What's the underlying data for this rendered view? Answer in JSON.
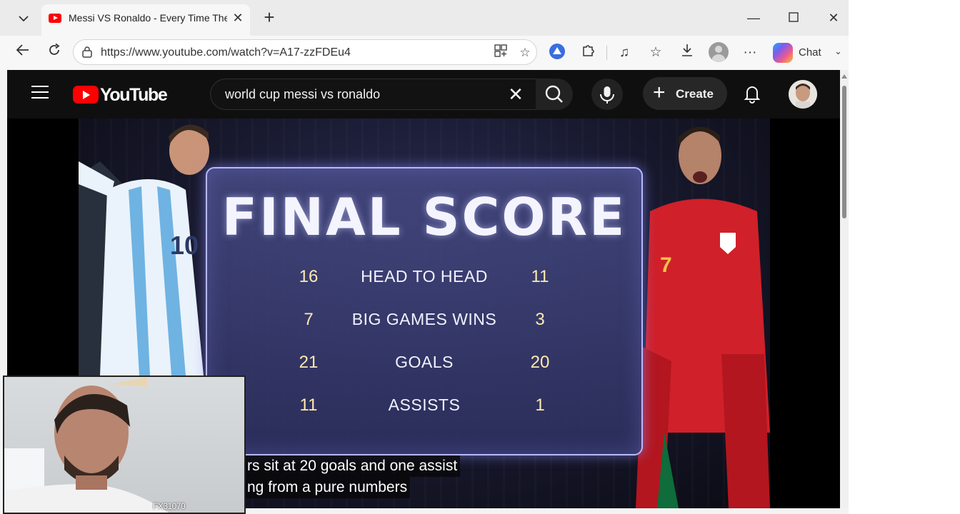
{
  "browser": {
    "tab": {
      "title": "Messi VS Ronaldo - Every Time The"
    },
    "address": {
      "url": "https://www.youtube.com/watch?v=A17-zzFDEu4"
    },
    "chat_label": "Chat"
  },
  "youtube": {
    "logo_text": "YouTube",
    "search_query": "world cup messi vs ronaldo",
    "create_label": "Create"
  },
  "video": {
    "title": "FINAL SCORE",
    "rows": [
      {
        "left": "16",
        "label": "HEAD TO HEAD",
        "right": "11"
      },
      {
        "left": "7",
        "label": "BIG GAMES WINS",
        "right": "3"
      },
      {
        "left": "21",
        "label": "GOALS",
        "right": "20"
      },
      {
        "left": "11",
        "label": "ASSISTS",
        "right": "1"
      }
    ],
    "captions": [
      "rs sit at 20 goals and one assist",
      "ng from a pure numbers"
    ],
    "messi_number": "10",
    "ronaldo_number": "7"
  },
  "webcam": {
    "label": "FX31070"
  },
  "colors": {
    "youtube_red": "#ff0000",
    "panel_border": "#b7b9ff",
    "yt_bg": "#0f0f0f"
  }
}
